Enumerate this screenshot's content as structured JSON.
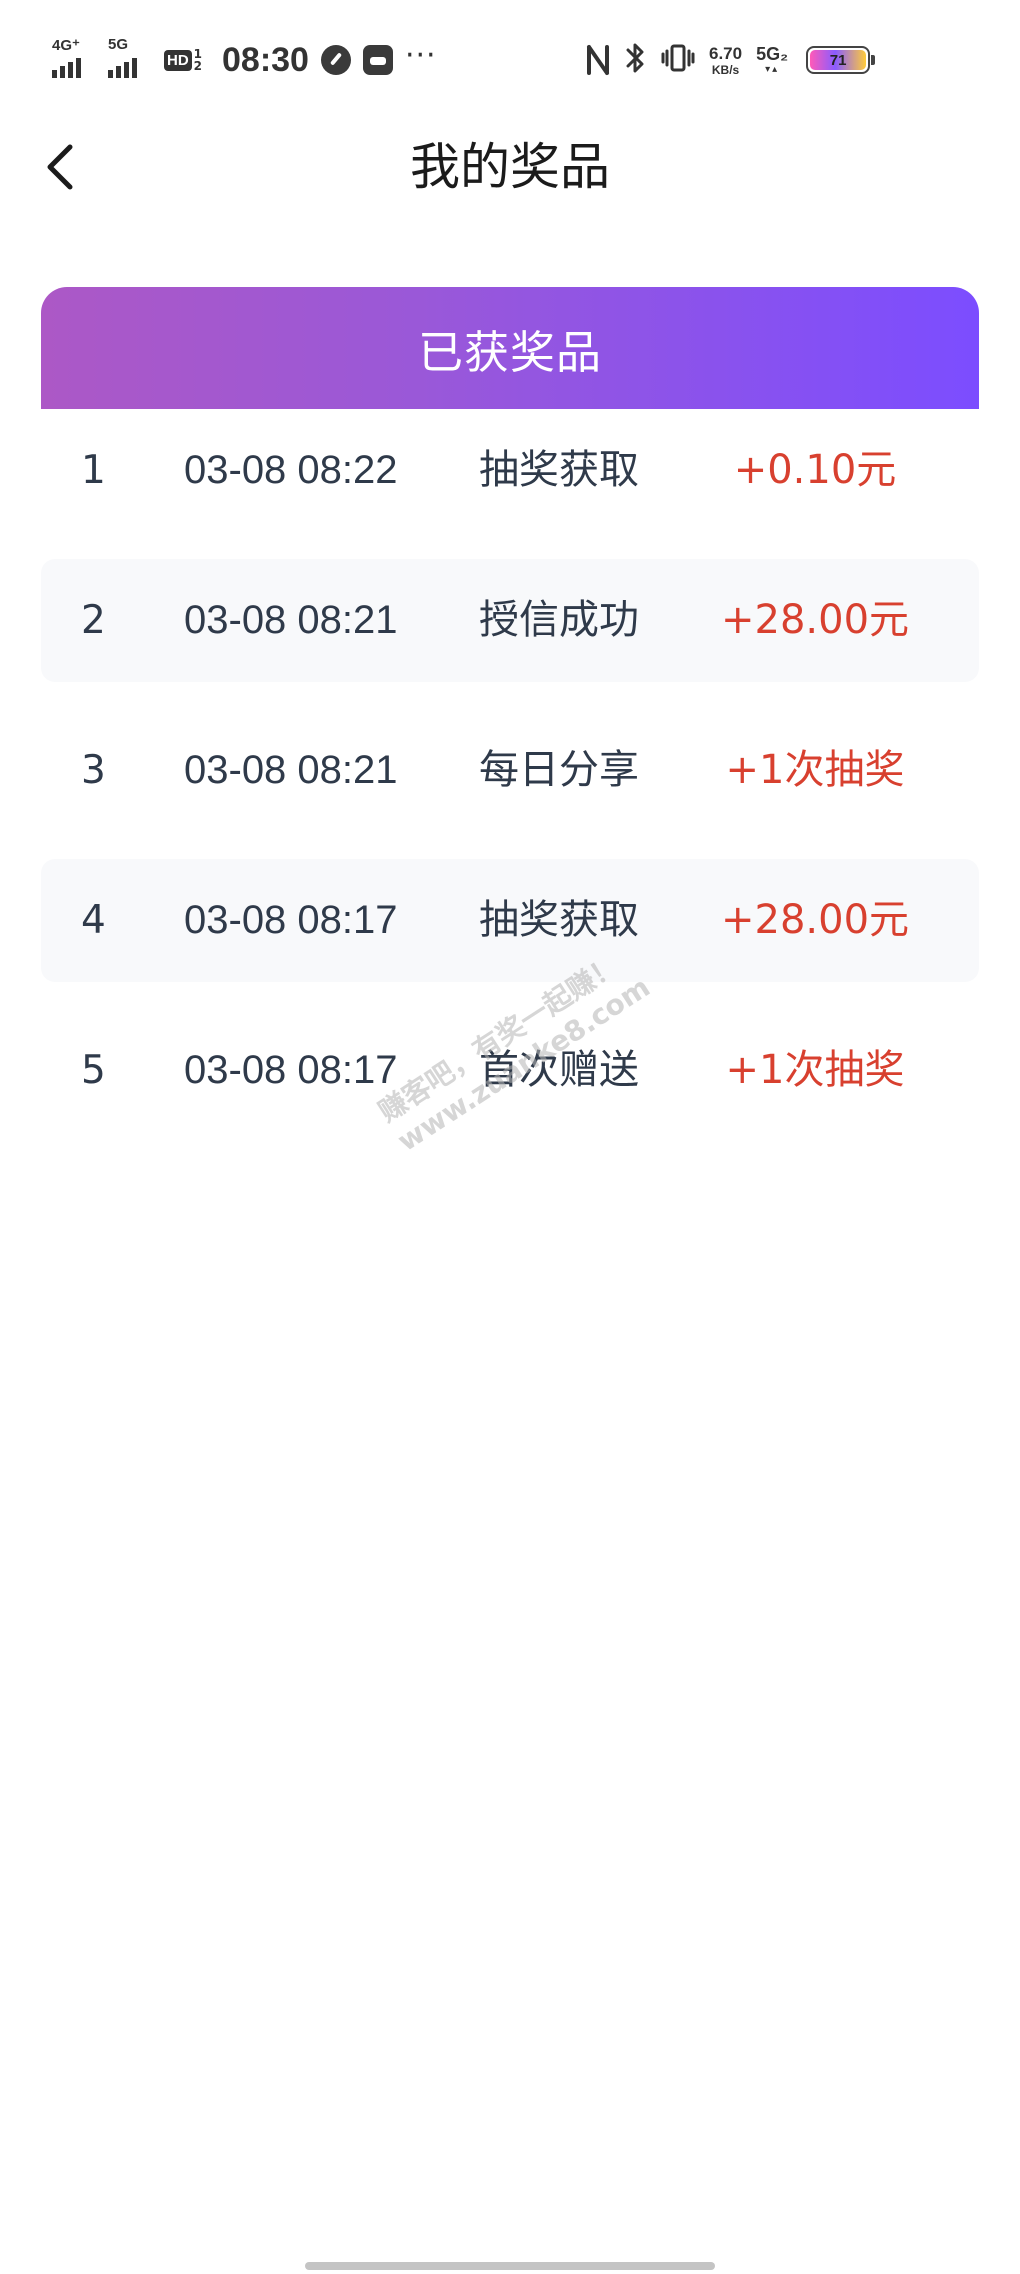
{
  "status_bar": {
    "network_1": "4G⁺",
    "network_2": "5G",
    "hd_label": "HD",
    "hd_sub": "1 2",
    "time": "08:30",
    "more": "···",
    "speed_value": "6.70",
    "speed_unit": "KB/s",
    "network_5g": "5G₂",
    "battery_level": "71",
    "icons": [
      "nfc-icon",
      "bluetooth-icon",
      "vibrate-icon"
    ]
  },
  "header": {
    "title": "我的奖品"
  },
  "banner": {
    "label": "已获奖品",
    "gradient_start": "#ac58c6",
    "gradient_end": "#7c4dff"
  },
  "prizes": [
    {
      "index": "1",
      "time": "03-08 08:22",
      "source": "抽奖获取",
      "amount": "+0.10元"
    },
    {
      "index": "2",
      "time": "03-08 08:21",
      "source": "授信成功",
      "amount": "+28.00元"
    },
    {
      "index": "3",
      "time": "03-08 08:21",
      "source": "每日分享",
      "amount": "+1次抽奖"
    },
    {
      "index": "4",
      "time": "03-08 08:17",
      "source": "抽奖获取",
      "amount": "+28.00元"
    },
    {
      "index": "5",
      "time": "03-08 08:17",
      "source": "首次赠送",
      "amount": "+1次抽奖"
    }
  ],
  "colors": {
    "amount": "#d8402f",
    "alt_row": "#f8f9fb"
  },
  "watermark": {
    "line1": "赚客吧，有奖一起赚！",
    "line2": "www.zuanke8.com"
  }
}
